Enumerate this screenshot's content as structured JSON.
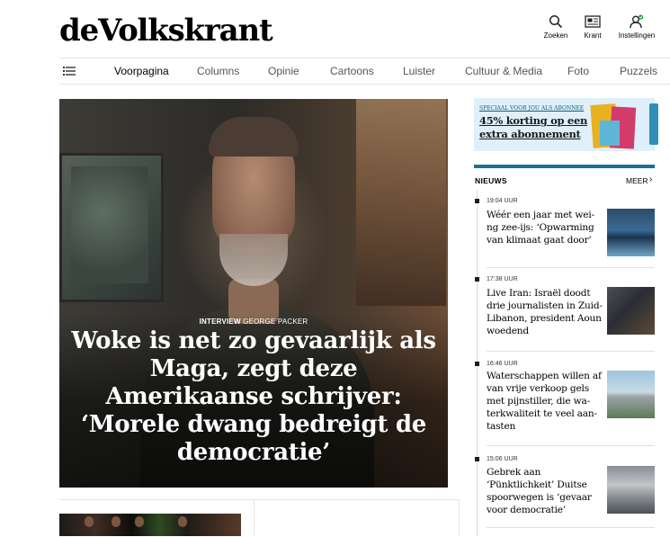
{
  "header": {
    "logo": "deVolkskrant",
    "icons": [
      {
        "name": "search-icon",
        "label": "Zoeken"
      },
      {
        "name": "newspaper-icon",
        "label": "Krant"
      },
      {
        "name": "user-settings-icon",
        "label": "Instellingen"
      }
    ]
  },
  "nav": {
    "items": [
      "Voorpagina",
      "Columns",
      "Opinie",
      "Cartoons",
      "Luister",
      "Cultuur & Media",
      "Foto",
      "Puzzels"
    ],
    "active": "Voorpagina"
  },
  "hero": {
    "kicker_label": "INTERVIEW",
    "kicker_name": "GEORGE PACKER",
    "title": "Woke is net zo gevaarlijk als Maga, zegt deze Amerikaanse schrijver: ‘Morele dwang bedreigt de democratie’"
  },
  "ad": {
    "small": "SPECIAAL VOOR JOU ALS ABONNEE",
    "line1": "45% korting op een",
    "line2": "extra abonnement"
  },
  "news": {
    "title": "NIEUWS",
    "more": "MEER",
    "items": [
      {
        "time": "19:04 UUR",
        "headline": "Wéér een jaar met wei-ng zee-ijs: ‘Opwarming van klimaat gaat door’"
      },
      {
        "time": "17:38 UUR",
        "headline": "Live Iran: Israël doodt drie journalisten in Zuid-Libanon, president Aoun woedend"
      },
      {
        "time": "16:46 UUR",
        "headline": "Waterschappen willen af van vrije verkoop gels met pijnstiller, die wa-terkwaliteit te veel aan-tasten"
      },
      {
        "time": "15:06 UUR",
        "headline": "Gebrek aan ‘Pünktlichkeit’ Duitse spoorwegen is ‘gevaar voor democratie’"
      }
    ]
  },
  "colors": {
    "brand_blue": "#1d6f95",
    "ad_background": "#dff0fa"
  }
}
